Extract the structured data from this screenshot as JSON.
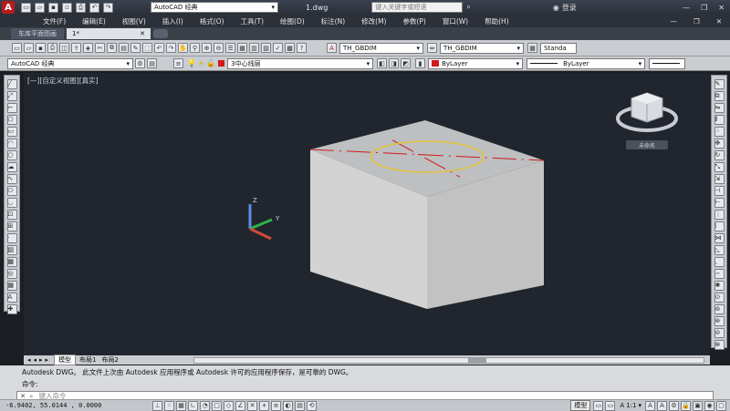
{
  "title_bar": {
    "workspace": "AutoCAD 经典",
    "file_name": "1.dwg",
    "search_placeholder": "键入关键字或短语",
    "login": "登录"
  },
  "menu": [
    "文件(F)",
    "编辑(E)",
    "视图(V)",
    "插入(I)",
    "格式(O)",
    "工具(T)",
    "绘图(D)",
    "标注(N)",
    "修改(M)",
    "参数(P)",
    "窗口(W)",
    "帮助(H)"
  ],
  "doc_tabs": [
    "车库平面图画",
    "1*"
  ],
  "toolbar": {
    "text_style": "TH_GBDIM",
    "dim_style": "TH_GBDIM",
    "table_style": "Standa",
    "workspace_combo": "AutoCAD 经典",
    "layer": "3中心线层",
    "color": "ByLayer",
    "linetype": "ByLayer"
  },
  "viewport": {
    "label": "[—][自定义视图][真实]",
    "viewcube_label": "未命名"
  },
  "layout_tabs": [
    "模型",
    "布局1",
    "布局2"
  ],
  "command_history": "Autodesk DWG。  此文件上次由 Autodesk 应用程序或 Autodesk 许可的应用程序保存，是可靠的 DWG。",
  "command_prompt": "命令:",
  "command_input_placeholder": "键入命令",
  "status": {
    "coords": "-6.9402,  55.0144 , 0.0000",
    "model": "模型",
    "scale": "1:1"
  },
  "colors": {
    "background": "#21262e",
    "accent_red": "#d11a1a",
    "circle_yellow": "#e2c23a"
  }
}
